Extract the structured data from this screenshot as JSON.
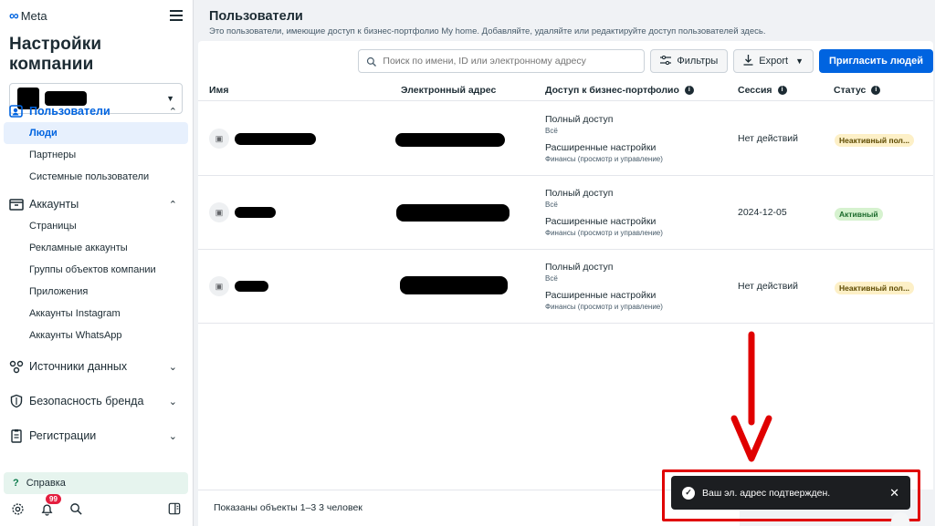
{
  "brand": {
    "logo_text": "Meta",
    "logo_symbol": "∞"
  },
  "sidebar": {
    "title": "Настройки компании",
    "groups": [
      {
        "label": "Пользователи",
        "icon": "users-icon",
        "expanded": true,
        "active": true,
        "items": [
          "Люди",
          "Партнеры",
          "Системные пользователи"
        ]
      },
      {
        "label": "Аккаунты",
        "icon": "accounts-icon",
        "expanded": true,
        "items": [
          "Страницы",
          "Рекламные аккаунты",
          "Группы объектов компании",
          "Приложения",
          "Аккаунты Instagram",
          "Аккаунты WhatsApp"
        ]
      },
      {
        "label": "Источники данных",
        "icon": "data-sources-icon",
        "expanded": false
      },
      {
        "label": "Безопасность бренда",
        "icon": "shield-icon",
        "expanded": false
      },
      {
        "label": "Регистрации",
        "icon": "registrations-icon",
        "expanded": false
      }
    ],
    "selected_item": "Люди",
    "help_label": "Справка",
    "notification_count": "99"
  },
  "page": {
    "title": "Пользователи",
    "description": "Это пользователи, имеющие доступ к бизнес-портфолио My home. Добавляйте, удаляйте или редактируйте доступ пользователей здесь."
  },
  "toolbar": {
    "search_placeholder": "Поиск по имени, ID или электронному адресу",
    "filters_label": "Фильтры",
    "export_label": "Export",
    "invite_label": "Пригласить людей"
  },
  "table": {
    "columns": [
      "Имя",
      "Электронный адрес",
      "Доступ к бизнес-портфолио",
      "Сессия",
      "Статус"
    ],
    "rows": [
      {
        "access_1": "Полный доступ",
        "access_1_sub": "Всё",
        "access_2": "Расширенные настройки",
        "access_2_sub": "Финансы (просмотр и управление)",
        "session": "Нет действий",
        "status": "Неактивный пол...",
        "status_kind": "inactive"
      },
      {
        "access_1": "Полный доступ",
        "access_1_sub": "Всё",
        "access_2": "Расширенные настройки",
        "access_2_sub": "Финансы (просмотр и управление)",
        "session": "2024-12-05",
        "status": "Активный",
        "status_kind": "active"
      },
      {
        "access_1": "Полный доступ",
        "access_1_sub": "Всё",
        "access_2": "Расширенные настройки",
        "access_2_sub": "Финансы (просмотр и управление)",
        "session": "Нет действий",
        "status": "Неактивный пол...",
        "status_kind": "inactive"
      }
    ]
  },
  "footer": {
    "text": "Показаны объекты 1–3 3 человек"
  },
  "toast": {
    "message": "Ваш эл. адрес подтвержден."
  },
  "colors": {
    "accent": "#0064e0",
    "annotation": "#e00000",
    "toast_bg": "#1c1e21"
  }
}
